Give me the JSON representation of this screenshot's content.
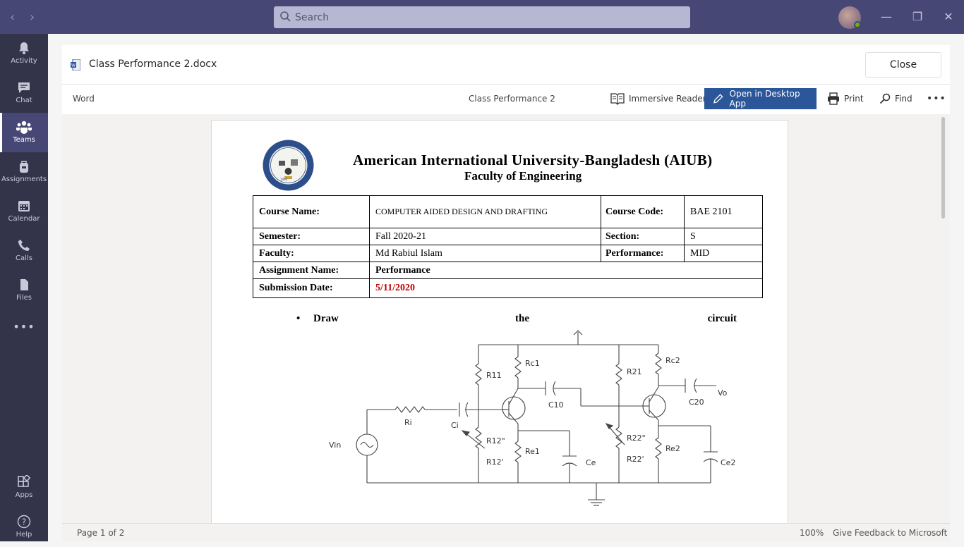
{
  "titlebar": {
    "search_placeholder": "Search",
    "window_controls": [
      "minimize",
      "restore",
      "close"
    ]
  },
  "rail": {
    "items": [
      {
        "label": "Activity",
        "icon": "bell-icon"
      },
      {
        "label": "Chat",
        "icon": "chat-icon"
      },
      {
        "label": "Teams",
        "icon": "teams-icon",
        "active": true
      },
      {
        "label": "Assignments",
        "icon": "backpack-icon"
      },
      {
        "label": "Calendar",
        "icon": "calendar-icon"
      },
      {
        "label": "Calls",
        "icon": "phone-icon"
      },
      {
        "label": "Files",
        "icon": "file-icon"
      },
      {
        "label": "Apps",
        "icon": "apps-icon"
      },
      {
        "label": "Help",
        "icon": "help-icon"
      }
    ],
    "more": "•••"
  },
  "docbar": {
    "file_name": "Class Performance 2.docx",
    "close_label": "Close"
  },
  "toolbar": {
    "app": "Word",
    "doc_title": "Class Performance 2",
    "immersive_reader": "Immersive Reader",
    "open_desktop": "Open in Desktop App",
    "print": "Print",
    "find": "Find",
    "more": "•••"
  },
  "document": {
    "university": "American International University-Bangladesh (AIUB)",
    "faculty": "Faculty of Engineering",
    "table": {
      "course_name_label": "Course Name:",
      "course_name": "COMPUTER AIDED DESIGN AND DRAFTING",
      "course_code_label": "Course Code:",
      "course_code": "BAE 2101",
      "semester_label": "Semester:",
      "semester": "Fall 2020-21",
      "section_label": "Section:",
      "section": "S",
      "faculty_label": "Faculty:",
      "faculty": "Md Rabiul Islam",
      "performance_label": "Performance:",
      "performance": "MID",
      "assignment_label": "Assignment Name:",
      "assignment": "Performance",
      "submission_label": "Submission Date:",
      "submission": "5/11/2020"
    },
    "bullet_words": [
      "Draw",
      "the",
      "circuit"
    ],
    "circuit_labels": {
      "rc1": "Rc1",
      "r11": "R11",
      "r21": "R21",
      "rc2": "Rc2",
      "c10": "C10",
      "c20": "C20",
      "vo": "Vo",
      "ri": "Ri",
      "ci": "Ci",
      "vin": "Vin",
      "r12a": "R12\"",
      "r12b": "R12'",
      "re1": "Re1",
      "ce": "Ce",
      "r22a": "R22\"",
      "r22b": "R22'",
      "re2": "Re2",
      "ce2": "Ce2"
    }
  },
  "status": {
    "page": "Page 1 of 2",
    "zoom": "100%",
    "feedback": "Give Feedback to Microsoft"
  }
}
